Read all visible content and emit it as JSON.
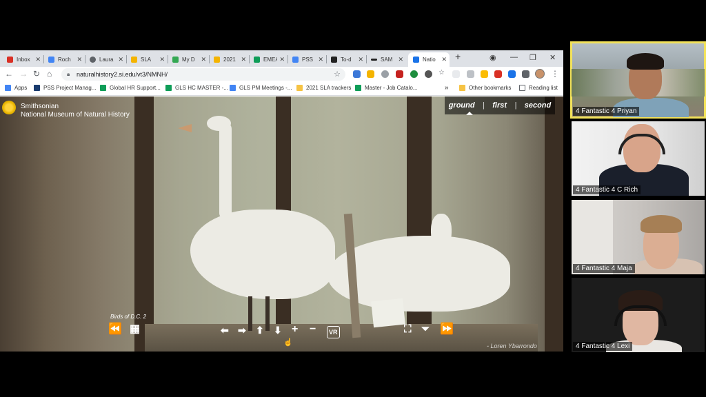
{
  "browser": {
    "tabs": [
      {
        "title": "Inbox",
        "favicon": "gmail-icon",
        "color": "#d93025"
      },
      {
        "title": "Roch",
        "favicon": "docs-icon",
        "color": "#4285f4"
      },
      {
        "title": "Laura",
        "favicon": "globe-icon",
        "color": "#5f6368"
      },
      {
        "title": "SLA",
        "favicon": "slides-icon",
        "color": "#f4b400"
      },
      {
        "title": "My D",
        "favicon": "drive-icon",
        "color": "#34a853"
      },
      {
        "title": "2021",
        "favicon": "slides-icon",
        "color": "#f4b400"
      },
      {
        "title": "EMEA",
        "favicon": "sheets-icon",
        "color": "#0f9d58"
      },
      {
        "title": "PSS",
        "favicon": "docs-icon",
        "color": "#4285f4"
      },
      {
        "title": "To-d",
        "favicon": "doc-icon",
        "color": "#222222"
      },
      {
        "title": "SAM",
        "favicon": "dash-icon",
        "color": "#222222"
      },
      {
        "title": "Natio",
        "favicon": "museum-icon",
        "color": "#1a73e8"
      }
    ],
    "url": "naturalhistory2.si.edu/vt3/NMNH/",
    "bookmarks": [
      {
        "label": "Apps",
        "icon": "apps-grid-icon",
        "color": "#4285f4"
      },
      {
        "label": "PSS Project Manag...",
        "icon": "project-icon",
        "color": "#1a3b6e"
      },
      {
        "label": "Global HR Support...",
        "icon": "sheets-icon",
        "color": "#0f9d58"
      },
      {
        "label": "GLS HC MASTER -...",
        "icon": "sheets-icon",
        "color": "#0f9d58"
      },
      {
        "label": "GLS PM Meetings -...",
        "icon": "docs-icon",
        "color": "#4285f4"
      },
      {
        "label": "2021 SLA trackers",
        "icon": "folder-icon",
        "color": "#f6c344"
      },
      {
        "label": "Master - Job Catalo...",
        "icon": "sheets-icon",
        "color": "#0f9d58"
      }
    ],
    "more_bookmarks": "»",
    "other_bookmarks": "Other bookmarks",
    "reading_list": "Reading list"
  },
  "tour": {
    "museum_line1": "Smithsonian",
    "museum_line2": "National Museum of Natural History",
    "floors": [
      "ground",
      "first",
      "second"
    ],
    "floor_separator": "|",
    "current_floor": "ground",
    "scene_title": "Birds of D.C. 2",
    "photo_credit": "- Loren Ybarrondo",
    "controls": {
      "rewind": "⏪",
      "grid": "▦",
      "left": "⬅",
      "right": "➡",
      "up": "⬆",
      "down": "⬇",
      "zoom_in": "+",
      "zoom_out": "−",
      "vr": "VR",
      "fullscreen": "⛶",
      "hide_bar": "⏷",
      "forward": "⏩"
    }
  },
  "participants": [
    {
      "name": "4 Fantastic 4 Priyan",
      "active": true
    },
    {
      "name": "4 Fantastic 4 C Rich",
      "active": false
    },
    {
      "name": "4 Fantastic 4 Maja",
      "active": false
    },
    {
      "name": "4 Fantastic 4 Lexi",
      "active": false
    }
  ]
}
